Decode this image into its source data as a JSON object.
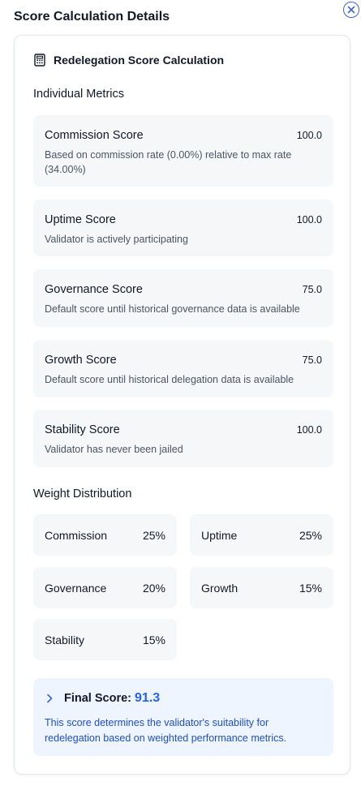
{
  "dialog": {
    "title": "Score Calculation Details",
    "close_label": "×"
  },
  "card": {
    "title": "Redelegation Score Calculation",
    "icon": "calculator-icon"
  },
  "metrics": {
    "section_title": "Individual Metrics",
    "items": [
      {
        "name": "Commission Score",
        "value": "100.0",
        "description": "Based on commission rate (0.00%) relative to max rate (34.00%)"
      },
      {
        "name": "Uptime Score",
        "value": "100.0",
        "description": "Validator is actively participating"
      },
      {
        "name": "Governance Score",
        "value": "75.0",
        "description": "Default score until historical governance data is available"
      },
      {
        "name": "Growth Score",
        "value": "75.0",
        "description": "Default score until historical delegation data is available"
      },
      {
        "name": "Stability Score",
        "value": "100.0",
        "description": "Validator has never been jailed"
      }
    ]
  },
  "weights": {
    "section_title": "Weight Distribution",
    "items": [
      {
        "name": "Commission",
        "value": "25%"
      },
      {
        "name": "Uptime",
        "value": "25%"
      },
      {
        "name": "Governance",
        "value": "20%"
      },
      {
        "name": "Growth",
        "value": "15%"
      },
      {
        "name": "Stability",
        "value": "15%"
      }
    ]
  },
  "final": {
    "label": "Final Score:",
    "value": "91.3",
    "description": "This score determines the validator's suitability for redelegation based on weighted performance metrics."
  },
  "colors": {
    "accent": "#2563eb",
    "final_bg": "#eff5ff",
    "metric_bg": "#f6f7f9"
  }
}
